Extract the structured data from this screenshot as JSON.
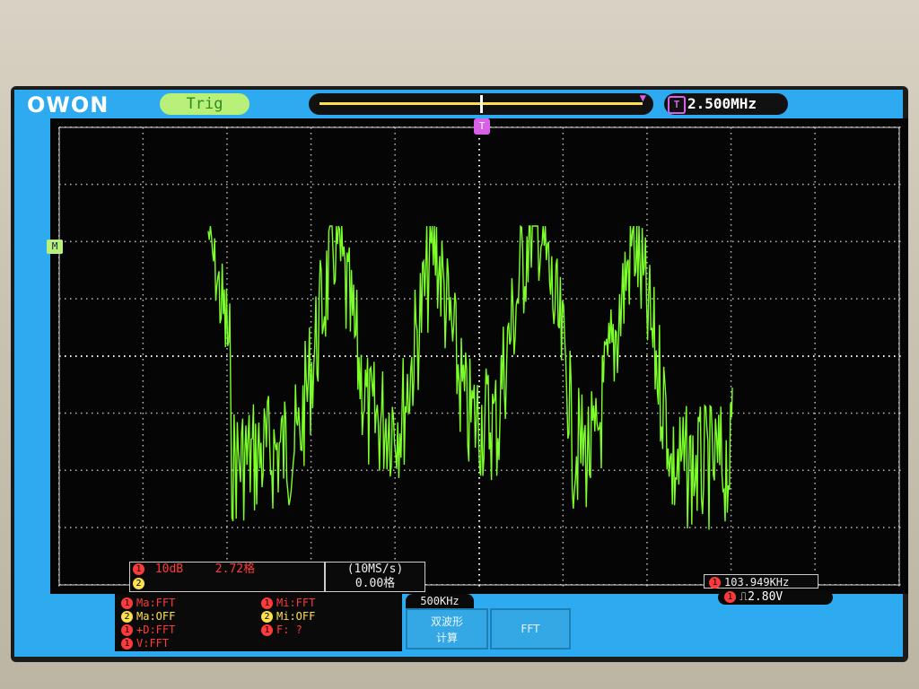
{
  "header": {
    "logo": "OWON",
    "trigger_status": "Trig",
    "trigger_frequency": "2.500MHz",
    "trigger_badge": "T"
  },
  "markers": {
    "trigger_position": "T",
    "math_marker": "M"
  },
  "channel_box": {
    "ch1_num": "1",
    "ch1_scale": "10dB",
    "ch1_value": "2.72格",
    "ch2_num": "2"
  },
  "timebase": {
    "sample_rate": "(10MS/s)",
    "offset": "0.00格"
  },
  "readouts": {
    "frequency_num": "1",
    "frequency": "103.949KHz",
    "trigger_num": "1",
    "trigger_edge": "⎍",
    "trigger_level": "2.80V"
  },
  "math_panel": {
    "ma1": "Ma:FFT",
    "mi1": "Mi:FFT",
    "ma2": "Ma:OFF",
    "mi2": "Mi:OFF",
    "d_fft": "+D:FFT",
    "f_val": "F:  ?",
    "v_fft": "V:FFT",
    "n1": "1",
    "n2": "2",
    "n3": "1",
    "n4": "2",
    "n5": "1",
    "n6": "1",
    "n7": "1"
  },
  "scale_label": "500KHz",
  "softkeys": {
    "dual_waveform_l1": "双波形",
    "dual_waveform_l2": "计算",
    "fft": "FFT"
  },
  "colors": {
    "screen_frame": "#2eaaf0",
    "plot_bg": "#050505",
    "trace": "#7dff2a",
    "ch1": "#ff3a3a",
    "ch2": "#ffe14d",
    "trigger": "#d760e6"
  }
}
